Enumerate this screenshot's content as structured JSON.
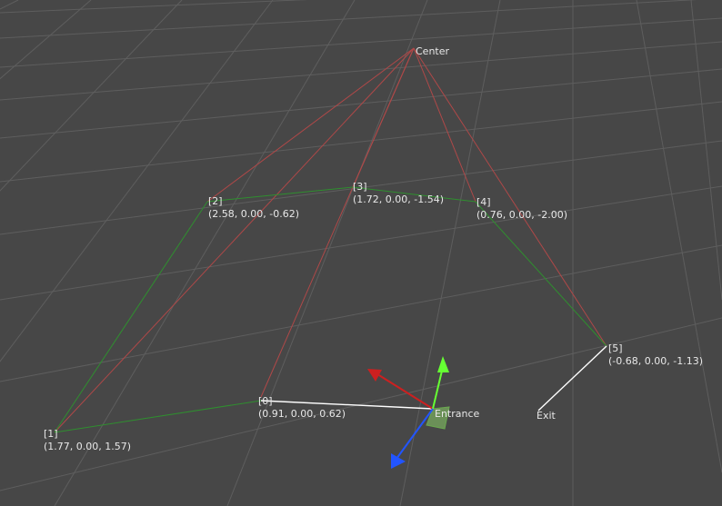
{
  "scene": {
    "background_color": "#474747",
    "grid_color": "#5e5e5e",
    "path_color": "#2f8f2f",
    "center_link_color": "#b04848",
    "active_link_color": "#ffffff",
    "axis_x_color": "#cc2020",
    "axis_y_color": "#66ff33",
    "axis_z_color": "#2255ff",
    "handle_plane_color": "#88cc66"
  },
  "center_label": "Center",
  "entrance_label": "Entrance",
  "exit_label": "Exit",
  "waypoints": [
    {
      "index": "[0]",
      "coords": "(0.91, 0.00, 0.62)"
    },
    {
      "index": "[1]",
      "coords": "(1.77, 0.00, 1.57)"
    },
    {
      "index": "[2]",
      "coords": "(2.58, 0.00, -0.62)"
    },
    {
      "index": "[3]",
      "coords": "(1.72, 0.00, -1.54)"
    },
    {
      "index": "[4]",
      "coords": "(0.76, 0.00, -2.00)"
    },
    {
      "index": "[5]",
      "coords": "(-0.68, 0.00, -1.13)"
    }
  ]
}
